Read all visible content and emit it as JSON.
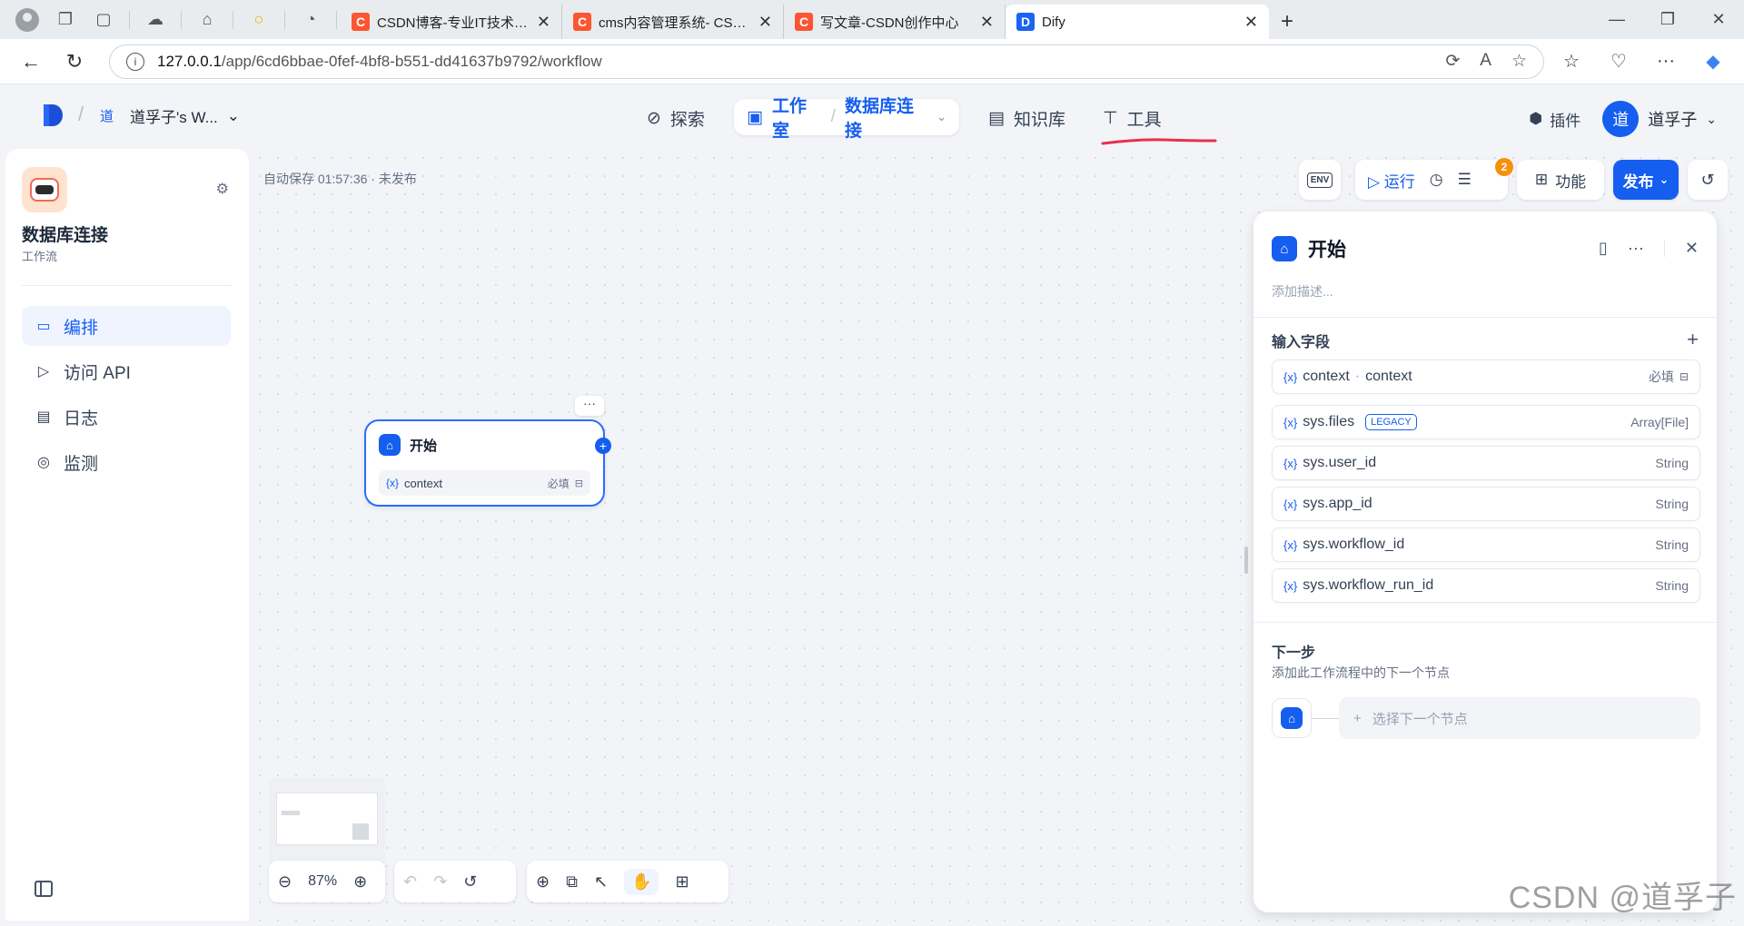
{
  "browser": {
    "tabs": [
      {
        "title": "CSDN博客-专业IT技术发表平台",
        "favicon": "C"
      },
      {
        "title": "cms内容管理系统- CSDN搜索",
        "favicon": "C"
      },
      {
        "title": "写文章-CSDN创作中心",
        "favicon": "C"
      },
      {
        "title": "Dify",
        "favicon": "D",
        "active": true
      }
    ],
    "url_host": "127.0.0.1",
    "url_path": "/app/6cd6bbae-0fef-4bf8-b551-dd41637b9792/workflow"
  },
  "header": {
    "workspace_badge": "道",
    "workspace_name": "道孚子's W...",
    "nav": {
      "explore": "探索",
      "studio": "工作室",
      "current_app": "数据库连接",
      "knowledge": "知识库",
      "tools": "工具"
    },
    "plugins": "插件",
    "user_initial": "道",
    "user_name": "道孚子"
  },
  "sidebar": {
    "app_name": "数据库连接",
    "app_type": "工作流",
    "items": [
      {
        "label": "编排",
        "icon": "layout-icon",
        "active": true
      },
      {
        "label": "访问 API",
        "icon": "terminal-icon"
      },
      {
        "label": "日志",
        "icon": "log-icon"
      },
      {
        "label": "监测",
        "icon": "monitor-icon"
      }
    ]
  },
  "canvas": {
    "autosave": "自动保存 01:57:36 · 未发布",
    "toolbar": {
      "env": "ENV",
      "run": "运行",
      "checklist_count": "2",
      "features": "功能",
      "publish": "发布"
    },
    "node": {
      "title": "开始",
      "var_name": "context",
      "var_required": "必填"
    },
    "zoom": "87%"
  },
  "panel": {
    "title": "开始",
    "description_placeholder": "添加描述...",
    "input_section": "输入字段",
    "input_fields": [
      {
        "name": "context",
        "label": "context",
        "required": "必填"
      }
    ],
    "sys_fields": [
      {
        "name": "sys.files",
        "badge": "LEGACY",
        "type": "Array[File]"
      },
      {
        "name": "sys.user_id",
        "type": "String"
      },
      {
        "name": "sys.app_id",
        "type": "String"
      },
      {
        "name": "sys.workflow_id",
        "type": "String"
      },
      {
        "name": "sys.workflow_run_id",
        "type": "String"
      }
    ],
    "next_title": "下一步",
    "next_desc": "添加此工作流程中的下一个节点",
    "next_select": "选择下一个节点"
  },
  "watermark": "CSDN @道孚子",
  "colors": {
    "accent": "#155eef",
    "badge": "#f79009",
    "csdn": "#fc5531",
    "annotation": "#e8304a"
  }
}
